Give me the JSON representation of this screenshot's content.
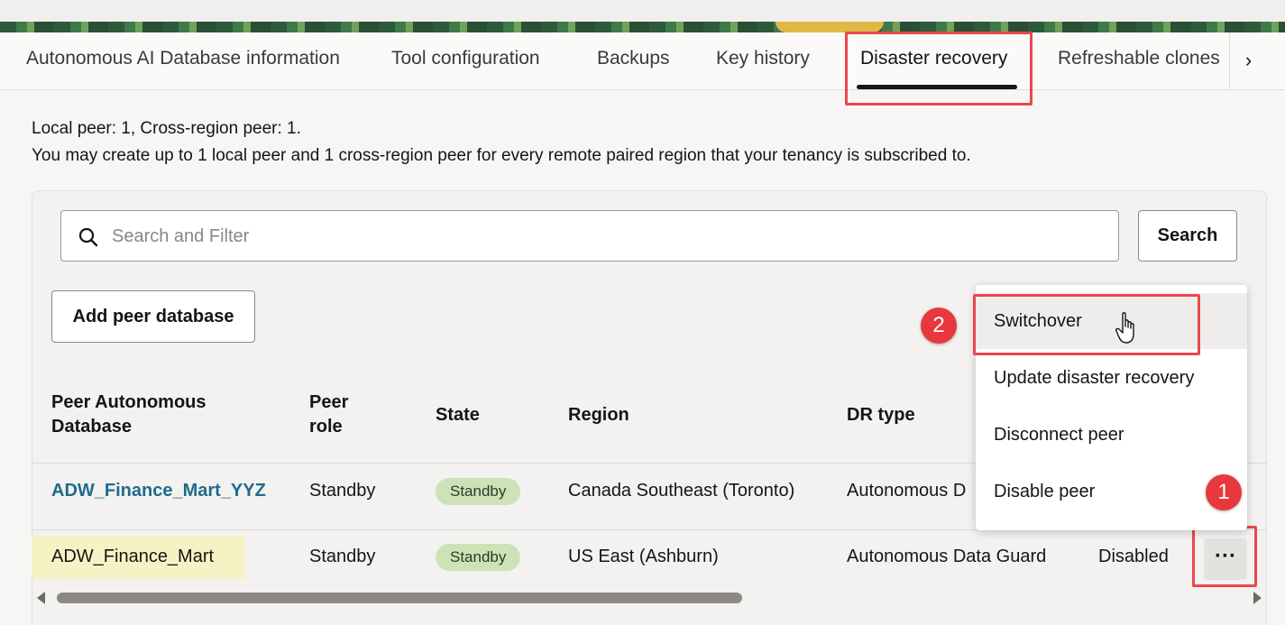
{
  "tabs": [
    {
      "label": "Autonomous AI Database information"
    },
    {
      "label": "Tool configuration"
    },
    {
      "label": "Backups"
    },
    {
      "label": "Key history"
    },
    {
      "label": "Disaster recovery",
      "active": true
    },
    {
      "label": "Refreshable clones"
    }
  ],
  "info": {
    "line1": "Local peer: 1, Cross-region peer: 1.",
    "line2": "You may create up to 1 local peer and 1 cross-region peer for every remote paired region that your tenancy is subscribed to."
  },
  "search": {
    "placeholder": "Search and Filter",
    "button_label": "Search"
  },
  "add_peer_button": "Add peer database",
  "table": {
    "headers": {
      "peer_db_line1": "Peer Autonomous",
      "peer_db_line2": "Database",
      "peer_role_line1": "Peer",
      "peer_role_line2": "role",
      "state": "State",
      "region": "Region",
      "dr_type": "DR type"
    },
    "rows": [
      {
        "name": "ADW_Finance_Mart_YYZ",
        "role": "Standby",
        "state": "Standby",
        "region": "Canada Southeast (Toronto)",
        "dr_type": "Autonomous D",
        "extra": ""
      },
      {
        "name": "ADW_Finance_Mart",
        "role": "Standby",
        "state": "Standby",
        "region": "US East (Ashburn)",
        "dr_type": "Autonomous Data Guard",
        "extra": "Disabled"
      }
    ]
  },
  "actions_menu": {
    "items": [
      "Switchover",
      "Update disaster recovery",
      "Disconnect peer",
      "Disable peer"
    ],
    "hovered": "Switchover"
  },
  "kebab_label": "···",
  "steps": {
    "one": "1",
    "two": "2"
  },
  "colors": {
    "highlight_red": "#e8484d",
    "link": "#1f6c8a",
    "badge_green": "#cde3b7",
    "step_red": "#e8383d"
  }
}
